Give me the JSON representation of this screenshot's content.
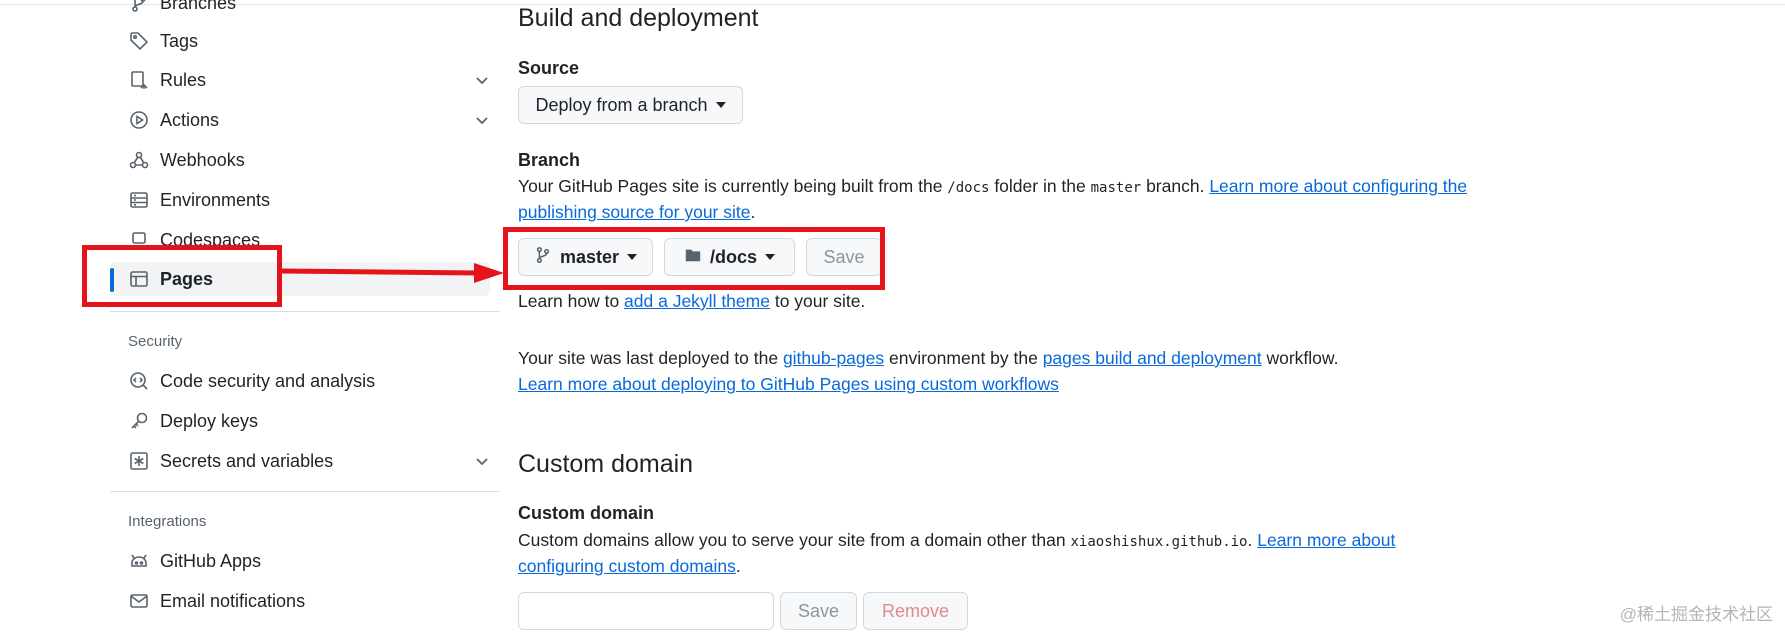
{
  "sidebar": {
    "items": [
      {
        "label": "Branches",
        "icon": "branch-icon"
      },
      {
        "label": "Tags",
        "icon": "tag-icon"
      },
      {
        "label": "Rules",
        "icon": "rules-icon"
      },
      {
        "label": "Actions",
        "icon": "play-icon"
      },
      {
        "label": "Webhooks",
        "icon": "webhook-icon"
      },
      {
        "label": "Environments",
        "icon": "server-icon"
      },
      {
        "label": "Codespaces",
        "icon": "codespaces-icon"
      },
      {
        "label": "Pages",
        "icon": "browser-icon"
      }
    ],
    "security_heading": "Security",
    "security_items": [
      {
        "label": "Code security and analysis",
        "icon": "codescan-icon"
      },
      {
        "label": "Deploy keys",
        "icon": "key-icon"
      },
      {
        "label": "Secrets and variables",
        "icon": "asterisk-icon"
      }
    ],
    "integrations_heading": "Integrations",
    "integrations_items": [
      {
        "label": "GitHub Apps",
        "icon": "apps-icon"
      },
      {
        "label": "Email notifications",
        "icon": "mail-icon"
      }
    ]
  },
  "build": {
    "title": "Build and deployment",
    "source_label": "Source",
    "source_value": "Deploy from a branch",
    "branch_label": "Branch",
    "branch_desc_1": "Your GitHub Pages site is currently being built from the ",
    "branch_folder_code": "/docs",
    "branch_desc_2": " folder in the ",
    "branch_name_code": "master",
    "branch_desc_3": " branch. ",
    "branch_link_1": "Learn more about configuring the",
    "branch_link_2": "publishing source for your site",
    "branch_desc_end": ".",
    "branch_button": "master",
    "folder_button": "/docs",
    "save_button": "Save",
    "jekyll_prefix": "Learn how to ",
    "jekyll_link": "add a Jekyll theme",
    "jekyll_suffix": " to your site.",
    "deployed_prefix": "Your site was last deployed to the ",
    "deployed_env_link": "github-pages",
    "deployed_mid": " environment by the ",
    "deployed_workflow_link": "pages build and deployment",
    "deployed_suffix": " workflow.",
    "custom_workflows_link": "Learn more about deploying to GitHub Pages using custom workflows"
  },
  "custom_domain": {
    "title": "Custom domain",
    "label": "Custom domain",
    "desc_1": "Custom domains allow you to serve your site from a domain other than ",
    "domain_code": "xiaoshishux.github.io",
    "desc_2": ". ",
    "link_1": "Learn more about",
    "link_2": "configuring custom domains",
    "desc_end": ".",
    "input_value": "",
    "save_button": "Save",
    "remove_button": "Remove"
  },
  "watermark": "@稀土掘金技术社区",
  "colors": {
    "accent": "#0969da",
    "annotation": "#e5141a"
  }
}
